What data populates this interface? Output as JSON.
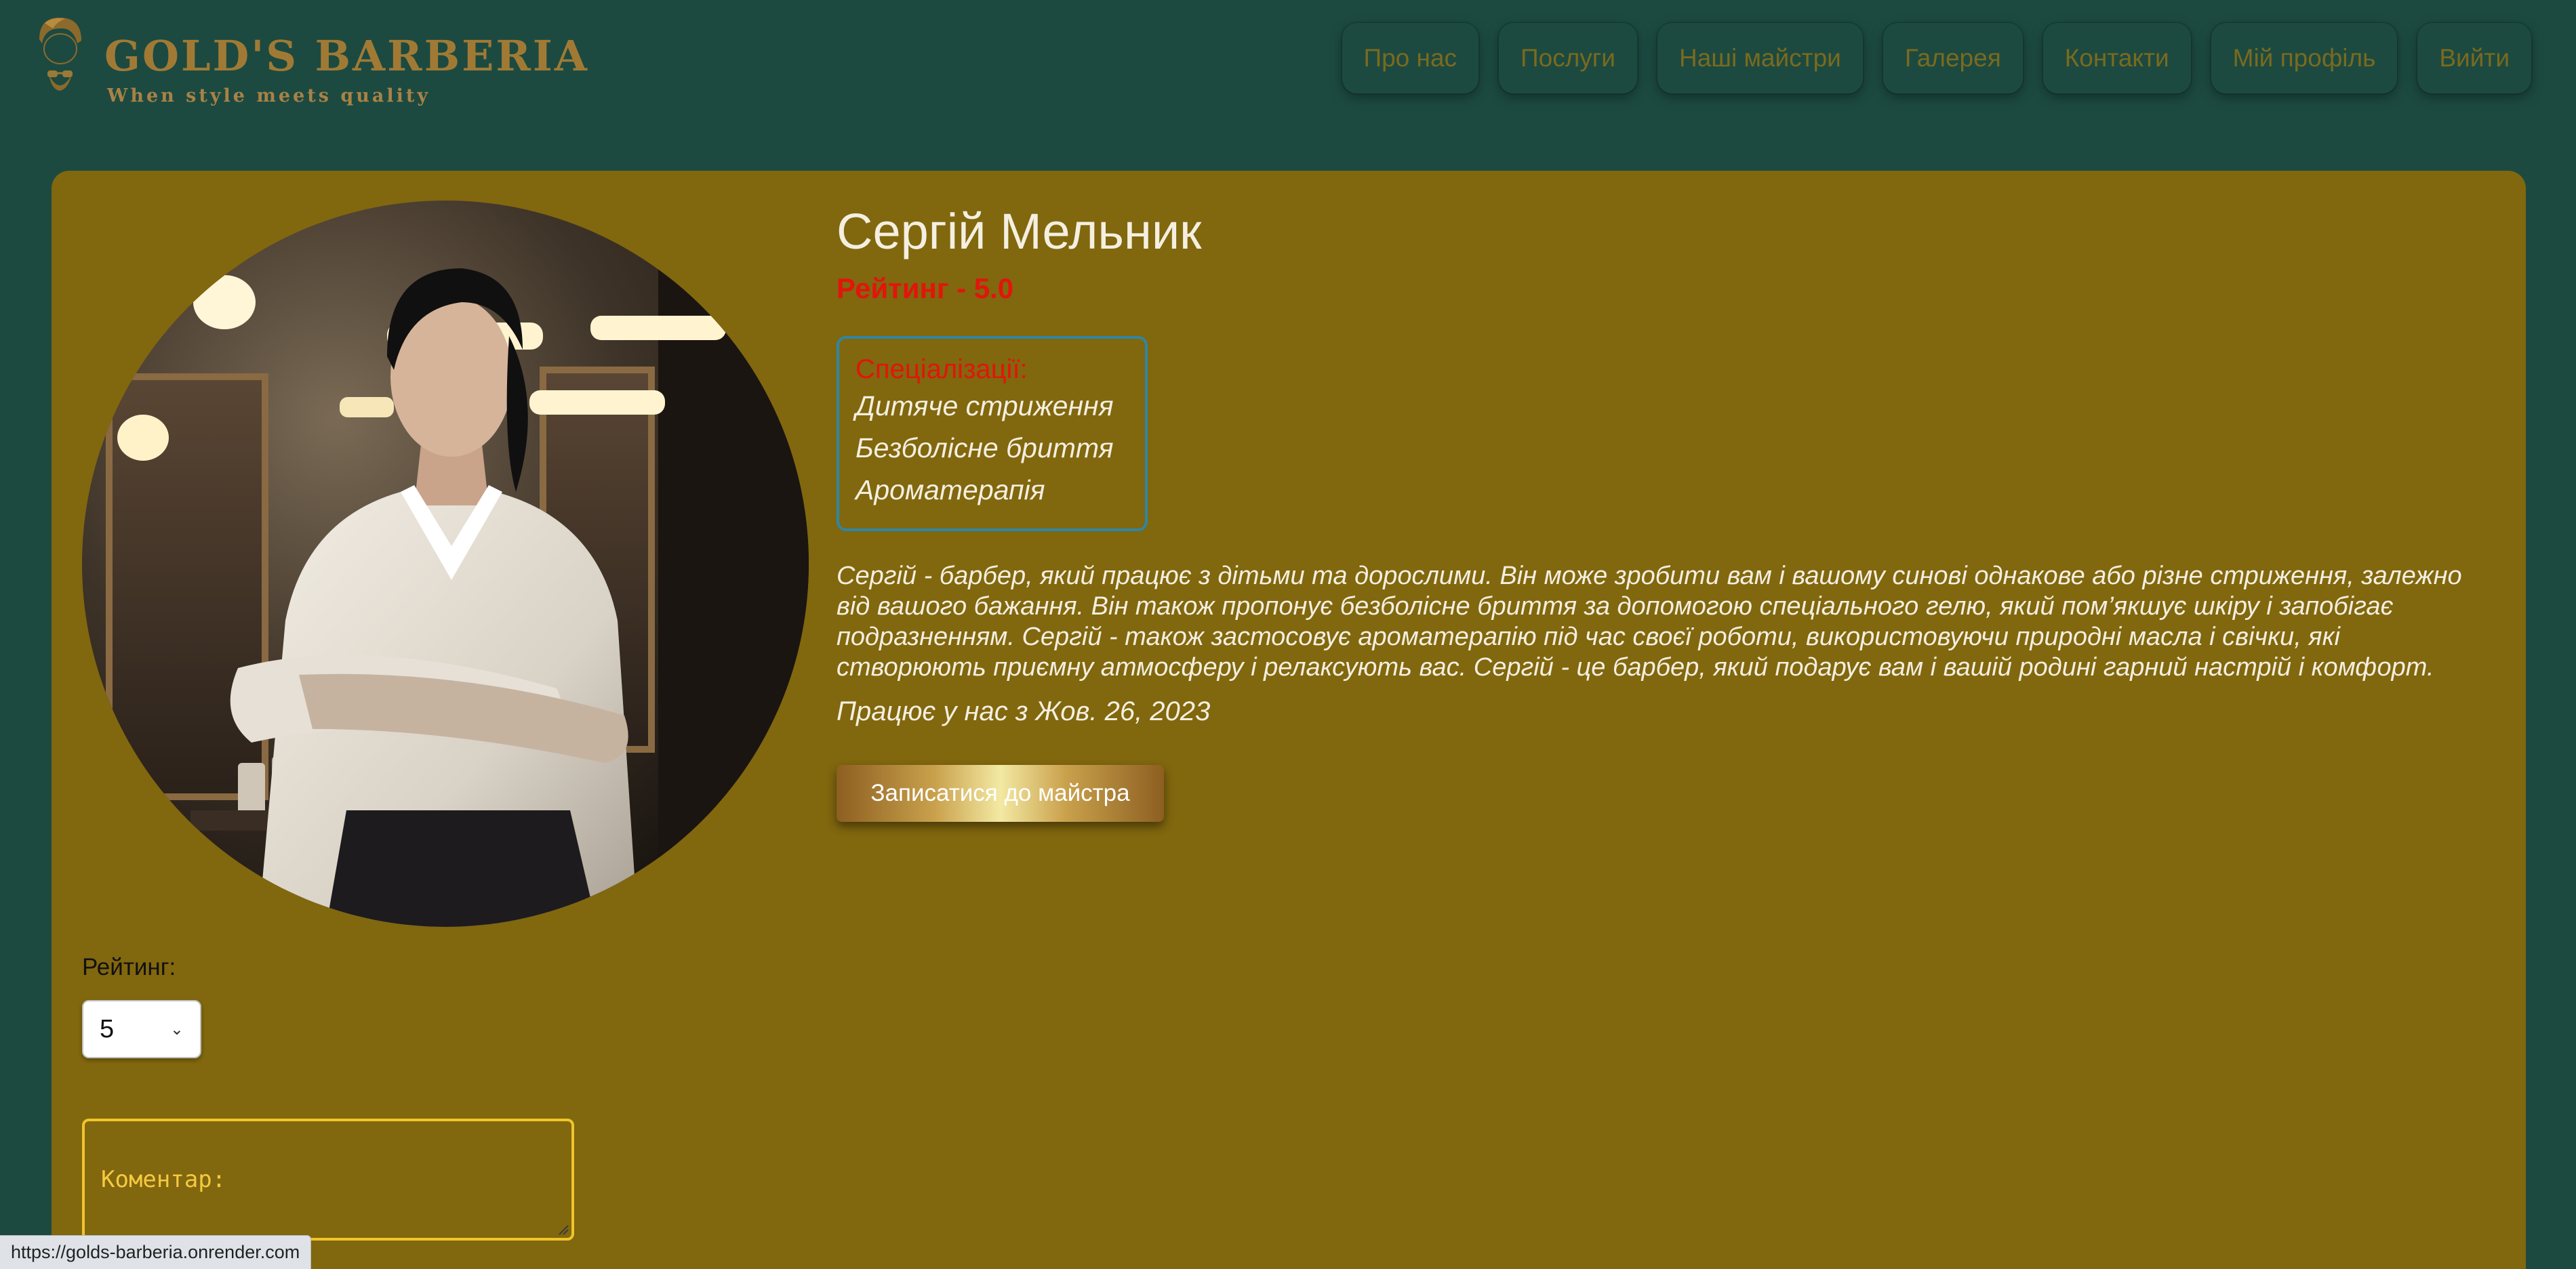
{
  "colors": {
    "background": "#1c4a41",
    "card": "#81670e",
    "gold": "#a07a34",
    "rating_red": "#e3140c",
    "spec_border": "#2e86a6",
    "comment_border": "#f0c52a"
  },
  "logo": {
    "title": "GOLD'S BARBERIA",
    "tagline": "When style meets quality",
    "icon": "barber-logo-icon"
  },
  "nav": {
    "items": [
      {
        "label": "Про нас"
      },
      {
        "label": "Послуги"
      },
      {
        "label": "Наші майстри"
      },
      {
        "label": "Галерея"
      },
      {
        "label": "Контакти"
      },
      {
        "label": "Мій профіль"
      },
      {
        "label": "Вийти"
      }
    ]
  },
  "barber": {
    "name": "Сергій Мельник",
    "rating_text": "Рейтинг - 5.0",
    "specializations_title": "Спеціалізації:",
    "specializations": [
      "Дитяче стриження",
      "Безболісне бриття",
      "Ароматерапія"
    ],
    "bio": "Сергій - барбер, який працює з дітьми та дорослими. Він може зробити вам і вашому синові однакове або різне стриження, залежно від вашого бажання. Він також пропонує безболісне бриття за допомогою спеціального гелю, який пом’якшує шкіру і запобігає подразненням. Сергій - також застосовує ароматерапію під час своєї роботи, використовуючи природні масла і свічки, які створюють приємну атмосферу і релаксують вас. Сергій - це барбер, який подарує вам і вашій родині гарний настрій і комфорт.",
    "since": "Працює у нас з Жов. 26, 2023",
    "book_label": "Записатися до майстра"
  },
  "review_form": {
    "rating_label": "Рейтинг:",
    "rating_value": "5",
    "comment_placeholder": "Коментар:"
  },
  "status_bar": {
    "url": "https://golds-barberia.onrender.com"
  }
}
